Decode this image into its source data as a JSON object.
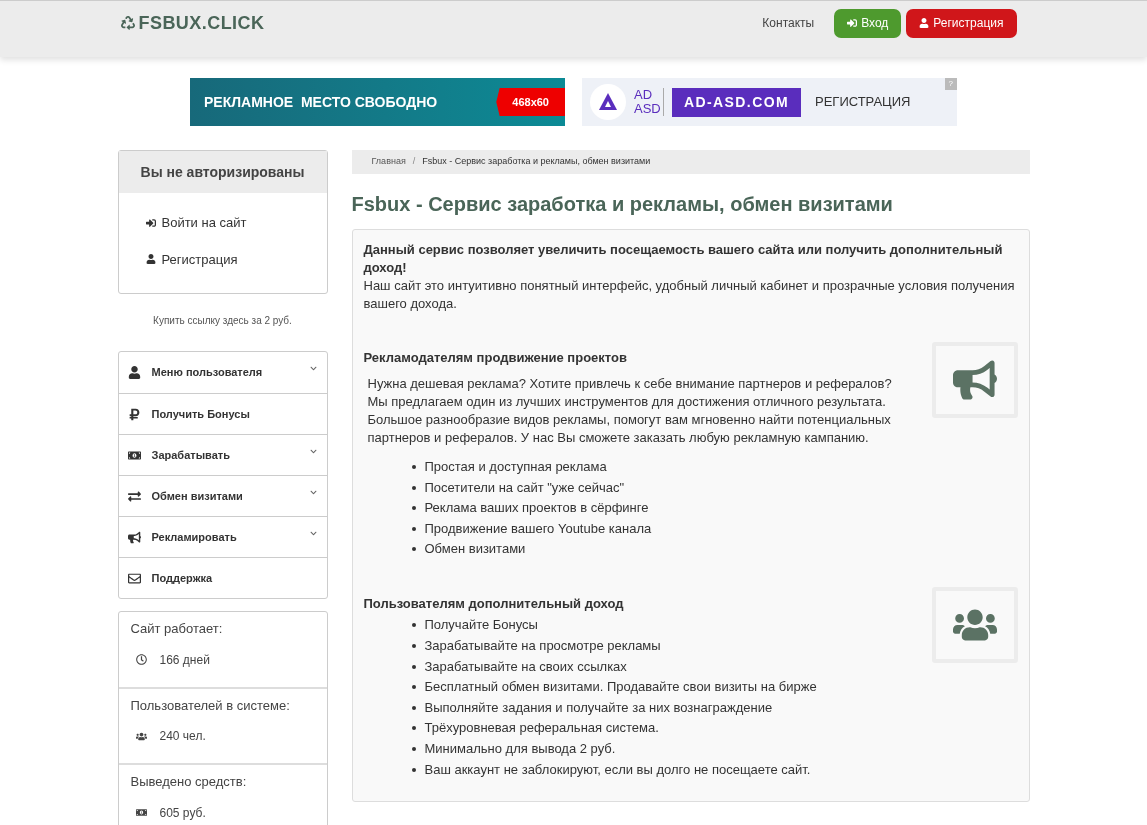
{
  "header": {
    "logo": "FSBUX.CLICK",
    "links": [
      {
        "kind": "link",
        "label": "Контакты"
      },
      {
        "kind": "login",
        "label": "Вход"
      },
      {
        "kind": "register",
        "label": "Регистрация"
      }
    ]
  },
  "banners": [
    {
      "kind": "free",
      "text": "РЕКЛАМНОЕ  МЕСТО СВОБОДНО",
      "size": "468x60"
    },
    {
      "kind": "adasd",
      "logo_text": "AD ASD",
      "domain": "AD-ASD.COM",
      "cta": "РЕГИСТРАЦИЯ",
      "corner": "?"
    }
  ],
  "auth_panel": {
    "title": "Вы не авторизированы",
    "links": [
      {
        "kind": "login",
        "label": "Войти на сайт"
      },
      {
        "kind": "user",
        "label": "Регистрация"
      }
    ]
  },
  "buy_link": "Купить ссылку здесь за 2 руб.",
  "menu": [
    {
      "kind": "user",
      "label": "Меню пользователя",
      "has_submenu": true
    },
    {
      "kind": "ruble",
      "label": "Получить Бонусы",
      "has_submenu": false
    },
    {
      "kind": "money",
      "label": "Зарабатывать",
      "has_submenu": true
    },
    {
      "kind": "exchange",
      "label": "Обмен визитами",
      "has_submenu": true
    },
    {
      "kind": "bullhorn",
      "label": "Рекламировать",
      "has_submenu": true
    },
    {
      "kind": "envelope",
      "label": "Поддержка",
      "has_submenu": false
    }
  ],
  "stats": [
    {
      "kind": "clock",
      "label": "Сайт работает:",
      "value": "166 дней"
    },
    {
      "kind": "users",
      "label": "Пользователей в системе:",
      "value": "240 чел."
    },
    {
      "kind": "money",
      "label": "Выведено средств:",
      "value": "605 руб."
    }
  ],
  "breadcrumb": [
    "Главная",
    "/",
    "Fsbux - Сервис заработка и рекламы, обмен визитами"
  ],
  "title": "Fsbux - Сервис заработка и рекламы, обмен визитами",
  "intro": {
    "lead": "Данный сервис позволяет увеличить посещаемость вашего сайта или получить дополнительный доход!",
    "text": "Наш сайт это интуитивно понятный интерфейс, удобный личный кабинет и прозрачные условия получения вашего дохода."
  },
  "sections": [
    {
      "kind": "bullhorn",
      "heading": "Рекламодателям продвижение проектов",
      "text": "Нужна дешевая реклама? Хотите привлечь к себе внимание партнеров и рефералов? Мы предлагаем один из лучших инструментов для достижения отличного результата. Большое разнообразие видов рекламы, помогут вам мгновенно найти потенциальных партнеров и рефералов. У нас Вы сможете заказать любую рекламную кампанию.",
      "items": [
        "Простая и доступная реклама",
        "Посетители на сайт \"уже сейчас\"",
        "Реклама ваших проектов в сёрфинге",
        "Продвижение вашего Youtube канала",
        "Обмен визитами"
      ]
    },
    {
      "kind": "users",
      "heading": "Пользователям дополнительный доход",
      "items": [
        "Получайте Бонусы",
        "Зарабатывайте на просмотре рекламы",
        "Зарабатывайте на своих ссылках",
        "Бесплатный обмен визитами. Продавайте свои визиты на бирже",
        "Выполняйте задания и получайте за них вознаграждение",
        "Трёхуровневая реферальная система.",
        "Минимально для вывода 2 руб.",
        "Ваш аккаунт не заблокируют, если вы долго не посещаете сайт."
      ]
    }
  ]
}
